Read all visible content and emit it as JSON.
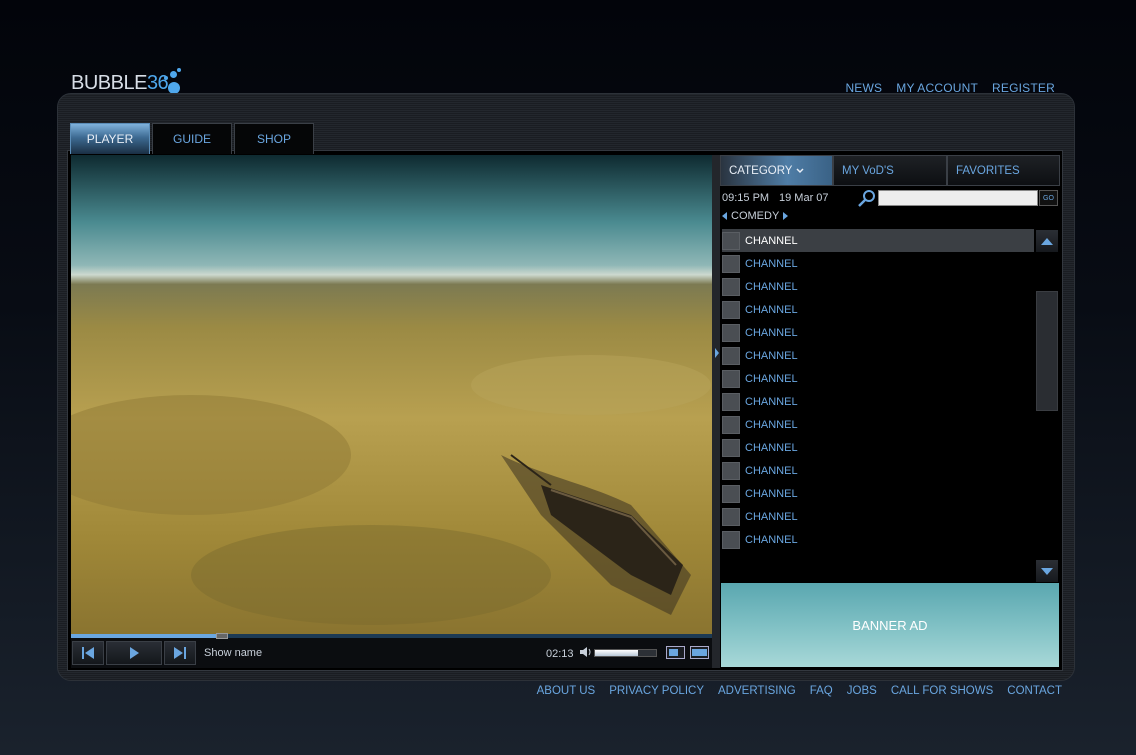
{
  "logo": {
    "word": "BUBBLE",
    "number": "36"
  },
  "top_nav": [
    {
      "label": "NEWS"
    },
    {
      "label": "MY ACCOUNT"
    },
    {
      "label": "REGISTER"
    }
  ],
  "tabs": [
    {
      "label": "PLAYER",
      "active": true
    },
    {
      "label": "GUIDE",
      "active": false
    },
    {
      "label": "SHOP",
      "active": false
    }
  ],
  "player": {
    "show_name": "Show name",
    "time": "02:13",
    "progress": 0.23,
    "volume": 0.7
  },
  "panel": {
    "tabs": [
      {
        "label": "CATEGORY",
        "active": true
      },
      {
        "label": "MY VoD'S",
        "active": false
      },
      {
        "label": "FAVORITES",
        "active": false
      }
    ],
    "time": "09:15 PM",
    "date": "19 Mar 07",
    "search": {
      "value": "",
      "button": "GO"
    },
    "category": "COMEDY",
    "channels": [
      {
        "name": "CHANNEL",
        "selected": true
      },
      {
        "name": "CHANNEL",
        "selected": false
      },
      {
        "name": "CHANNEL",
        "selected": false
      },
      {
        "name": "CHANNEL",
        "selected": false
      },
      {
        "name": "CHANNEL",
        "selected": false
      },
      {
        "name": "CHANNEL",
        "selected": false
      },
      {
        "name": "CHANNEL",
        "selected": false
      },
      {
        "name": "CHANNEL",
        "selected": false
      },
      {
        "name": "CHANNEL",
        "selected": false
      },
      {
        "name": "CHANNEL",
        "selected": false
      },
      {
        "name": "CHANNEL",
        "selected": false
      },
      {
        "name": "CHANNEL",
        "selected": false
      },
      {
        "name": "CHANNEL",
        "selected": false
      },
      {
        "name": "CHANNEL",
        "selected": false
      }
    ],
    "banner": "BANNER AD"
  },
  "footer_nav": [
    {
      "label": "ABOUT US"
    },
    {
      "label": "PRIVACY POLICY"
    },
    {
      "label": "ADVERTISING"
    },
    {
      "label": "FAQ"
    },
    {
      "label": "JOBS"
    },
    {
      "label": "CALL FOR SHOWS"
    },
    {
      "label": "CONTACT"
    }
  ],
  "colors": {
    "accent": "#6aa6e0",
    "background": "#05080d",
    "banner": "#7fc0c4"
  }
}
